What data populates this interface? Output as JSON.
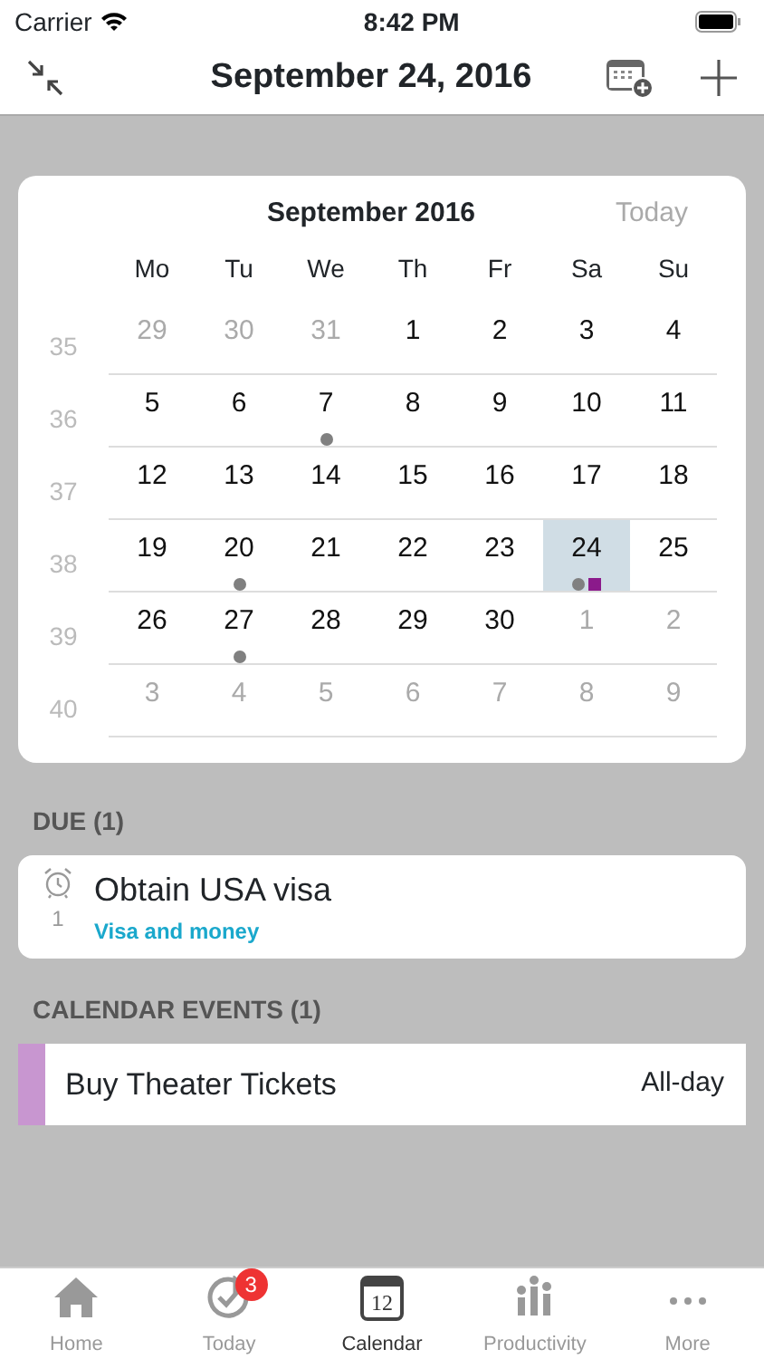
{
  "status_bar": {
    "carrier": "Carrier",
    "time": "8:42 PM"
  },
  "header": {
    "title": "September 24, 2016"
  },
  "calendar": {
    "title": "September 2016",
    "today_button": "Today",
    "weekdays": [
      "Mo",
      "Tu",
      "We",
      "Th",
      "Fr",
      "Sa",
      "Su"
    ],
    "weeks": [
      {
        "number": "35",
        "days": [
          {
            "label": "29",
            "in_month": false,
            "selected": false
          },
          {
            "label": "30",
            "in_month": false,
            "selected": false
          },
          {
            "label": "31",
            "in_month": false,
            "selected": false
          },
          {
            "label": "1",
            "in_month": true,
            "selected": false
          },
          {
            "label": "2",
            "in_month": true,
            "selected": false
          },
          {
            "label": "3",
            "in_month": true,
            "selected": false
          },
          {
            "label": "4",
            "in_month": true,
            "selected": false
          }
        ]
      },
      {
        "number": "36",
        "days": [
          {
            "label": "5",
            "in_month": true,
            "selected": false
          },
          {
            "label": "6",
            "in_month": true,
            "selected": false
          },
          {
            "label": "7",
            "in_month": true,
            "selected": false,
            "markers": [
              {
                "kind": "dot",
                "color": "#808080"
              }
            ]
          },
          {
            "label": "8",
            "in_month": true,
            "selected": false
          },
          {
            "label": "9",
            "in_month": true,
            "selected": false
          },
          {
            "label": "10",
            "in_month": true,
            "selected": false
          },
          {
            "label": "11",
            "in_month": true,
            "selected": false
          }
        ]
      },
      {
        "number": "37",
        "days": [
          {
            "label": "12",
            "in_month": true,
            "selected": false
          },
          {
            "label": "13",
            "in_month": true,
            "selected": false
          },
          {
            "label": "14",
            "in_month": true,
            "selected": false
          },
          {
            "label": "15",
            "in_month": true,
            "selected": false
          },
          {
            "label": "16",
            "in_month": true,
            "selected": false
          },
          {
            "label": "17",
            "in_month": true,
            "selected": false
          },
          {
            "label": "18",
            "in_month": true,
            "selected": false
          }
        ]
      },
      {
        "number": "38",
        "days": [
          {
            "label": "19",
            "in_month": true,
            "selected": false
          },
          {
            "label": "20",
            "in_month": true,
            "selected": false,
            "markers": [
              {
                "kind": "dot",
                "color": "#808080"
              }
            ]
          },
          {
            "label": "21",
            "in_month": true,
            "selected": false
          },
          {
            "label": "22",
            "in_month": true,
            "selected": false
          },
          {
            "label": "23",
            "in_month": true,
            "selected": false
          },
          {
            "label": "24",
            "in_month": true,
            "selected": true,
            "markers": [
              {
                "kind": "dot",
                "color": "#808080"
              },
              {
                "kind": "square",
                "color": "#8b1a8b"
              }
            ]
          },
          {
            "label": "25",
            "in_month": true,
            "selected": false
          }
        ]
      },
      {
        "number": "39",
        "days": [
          {
            "label": "26",
            "in_month": true,
            "selected": false
          },
          {
            "label": "27",
            "in_month": true,
            "selected": false,
            "markers": [
              {
                "kind": "dot",
                "color": "#808080"
              }
            ]
          },
          {
            "label": "28",
            "in_month": true,
            "selected": false
          },
          {
            "label": "29",
            "in_month": true,
            "selected": false
          },
          {
            "label": "30",
            "in_month": true,
            "selected": false
          },
          {
            "label": "1",
            "in_month": false,
            "selected": false
          },
          {
            "label": "2",
            "in_month": false,
            "selected": false
          }
        ]
      },
      {
        "number": "40",
        "days": [
          {
            "label": "3",
            "in_month": false,
            "selected": false
          },
          {
            "label": "4",
            "in_month": false,
            "selected": false
          },
          {
            "label": "5",
            "in_month": false,
            "selected": false
          },
          {
            "label": "6",
            "in_month": false,
            "selected": false
          },
          {
            "label": "7",
            "in_month": false,
            "selected": false
          },
          {
            "label": "8",
            "in_month": false,
            "selected": false
          },
          {
            "label": "9",
            "in_month": false,
            "selected": false
          }
        ]
      }
    ]
  },
  "due": {
    "heading": "DUE (1)",
    "items": [
      {
        "title": "Obtain USA visa",
        "count": "1",
        "list": "Visa and money"
      }
    ]
  },
  "events": {
    "heading": "CALENDAR EVENTS (1)",
    "items": [
      {
        "title": "Buy Theater Tickets",
        "time": "All-day",
        "color": "#c896d0"
      }
    ]
  },
  "tab_bar": {
    "tabs": [
      {
        "kind": "home",
        "label": "Home",
        "selected": false
      },
      {
        "kind": "today",
        "label": "Today",
        "selected": false,
        "badge": "3"
      },
      {
        "kind": "calendar",
        "label": "Calendar",
        "selected": true,
        "icon_text": "12"
      },
      {
        "kind": "productivity",
        "label": "Productivity",
        "selected": false
      },
      {
        "kind": "more",
        "label": "More",
        "selected": false
      }
    ]
  }
}
